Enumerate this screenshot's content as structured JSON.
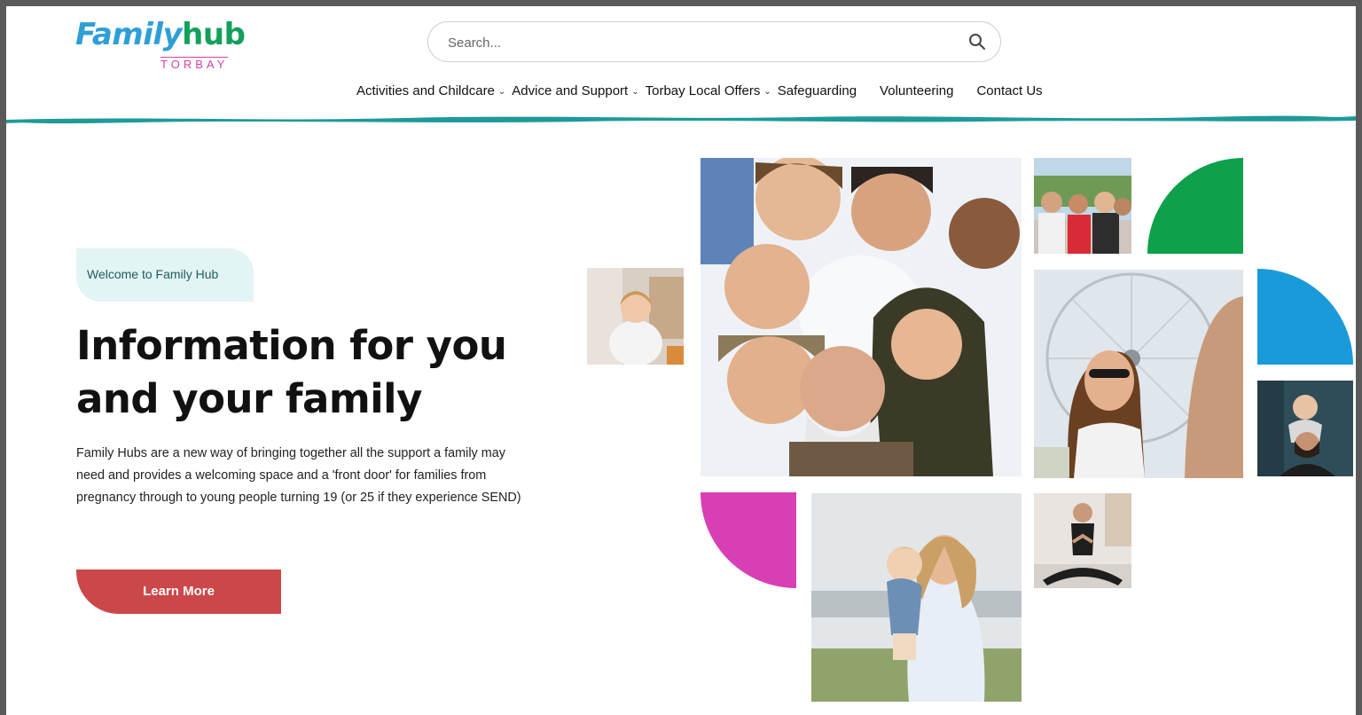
{
  "logo": {
    "main_left": "Family",
    "main_right": "hub",
    "sub": "TORBAY"
  },
  "search": {
    "placeholder": "Search..."
  },
  "nav": {
    "items": [
      {
        "label": "Activities and Childcare",
        "has_dropdown": true
      },
      {
        "label": "Advice and Support",
        "has_dropdown": true
      },
      {
        "label": "Torbay Local Offers",
        "has_dropdown": true
      },
      {
        "label": "Safeguarding",
        "has_dropdown": false
      },
      {
        "label": "Volunteering",
        "has_dropdown": false
      },
      {
        "label": "Contact Us",
        "has_dropdown": false
      }
    ]
  },
  "hero": {
    "badge": "Welcome to Family Hub",
    "title_line1": "Information for you",
    "title_line2": "and your family",
    "description": "Family Hubs are a new way of bringing together all the support a family may need and provides a welcoming space and a 'front door' for families from pregnancy through to young people turning 19 (or 25 if they experience SEND)",
    "cta": "Learn More"
  },
  "colors": {
    "brand_blue": "#2e9fd6",
    "brand_green": "#12a05a",
    "brand_pink": "#d63fa8",
    "teal_wave": "#1e9a9a",
    "cta_red": "#cc4749",
    "shape_green": "#0ea04a",
    "shape_blue": "#1a9ad9",
    "shape_magenta": "#d83fb5"
  },
  "icons": {
    "search": "search-icon",
    "dropdown": "chevron-down-icon"
  }
}
